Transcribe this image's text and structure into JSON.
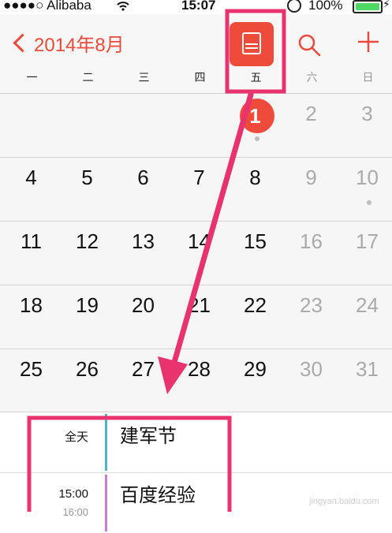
{
  "status_bar": {
    "carrier": "●●●●○ Alibaba",
    "time": "15:07",
    "battery": "100%"
  },
  "header": {
    "back_label": "2014年8月",
    "accent_color": "#ef4b3b",
    "actions": [
      "list-view-icon",
      "search-icon",
      "add-icon"
    ]
  },
  "weekdays": [
    "一",
    "二",
    "三",
    "四",
    "五",
    "六",
    "日"
  ],
  "calendar": {
    "rows": [
      [
        "",
        "",
        "",
        "",
        "1",
        "2",
        "3"
      ],
      [
        "4",
        "5",
        "6",
        "7",
        "8",
        "9",
        "10"
      ],
      [
        "11",
        "12",
        "13",
        "14",
        "15",
        "16",
        "17"
      ],
      [
        "18",
        "19",
        "20",
        "21",
        "22",
        "23",
        "24"
      ],
      [
        "25",
        "26",
        "27",
        "28",
        "29",
        "30",
        "31"
      ]
    ],
    "today": "1",
    "days_with_events": [
      "1",
      "10"
    ]
  },
  "events": [
    {
      "time": "全天",
      "title": "建军节",
      "color": "#4fb6c9"
    },
    {
      "time": "15:00",
      "end_time": "16:00",
      "title": "百度经验",
      "color": "#c77dd0"
    }
  ],
  "annotation_color": "#e8336f"
}
